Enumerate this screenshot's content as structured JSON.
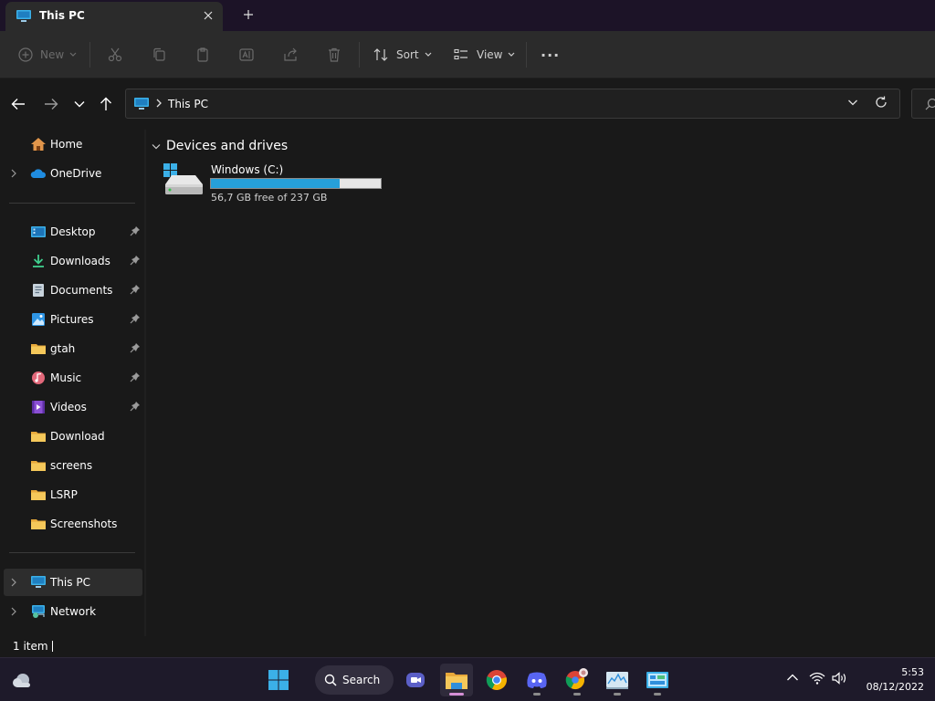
{
  "window": {
    "tab_title": "This PC",
    "new_tab_symbol": "+"
  },
  "toolbar": {
    "new_label": "New",
    "sort_label": "Sort",
    "view_label": "View",
    "more_label": "···"
  },
  "address": {
    "path": "This PC"
  },
  "sidebar": {
    "items": [
      {
        "label": "Home",
        "icon": "home-icon",
        "pinned": false
      },
      {
        "label": "OneDrive",
        "icon": "onedrive-icon",
        "pinned": false
      },
      {
        "label": "Desktop",
        "icon": "desktop-icon",
        "pinned": true
      },
      {
        "label": "Downloads",
        "icon": "downloads-icon",
        "pinned": true
      },
      {
        "label": "Documents",
        "icon": "documents-icon",
        "pinned": true
      },
      {
        "label": "Pictures",
        "icon": "pictures-icon",
        "pinned": true
      },
      {
        "label": "gtah",
        "icon": "folder-icon",
        "pinned": true
      },
      {
        "label": "Music",
        "icon": "music-icon",
        "pinned": true
      },
      {
        "label": "Videos",
        "icon": "videos-icon",
        "pinned": true
      },
      {
        "label": "Download",
        "icon": "folder-icon",
        "pinned": false
      },
      {
        "label": "screens",
        "icon": "folder-icon",
        "pinned": false
      },
      {
        "label": "LSRP",
        "icon": "folder-icon",
        "pinned": false
      },
      {
        "label": "Screenshots",
        "icon": "folder-icon",
        "pinned": false
      },
      {
        "label": "This PC",
        "icon": "this-pc-icon",
        "pinned": false
      },
      {
        "label": "Network",
        "icon": "network-icon",
        "pinned": false
      }
    ]
  },
  "main": {
    "group_title": "Devices and drives",
    "drives": [
      {
        "name": "Windows (C:)",
        "free_text": "56,7 GB free of 237 GB",
        "used_fraction": 0.76
      }
    ]
  },
  "status": {
    "item_count": "1 item"
  },
  "taskbar": {
    "search_label": "Search",
    "time": "5:53",
    "date": "08/12/2022"
  },
  "colors": {
    "accent": "#26a0da",
    "folder": "#f2c14e",
    "background": "#191919",
    "taskbar": "#1e1a2a"
  }
}
